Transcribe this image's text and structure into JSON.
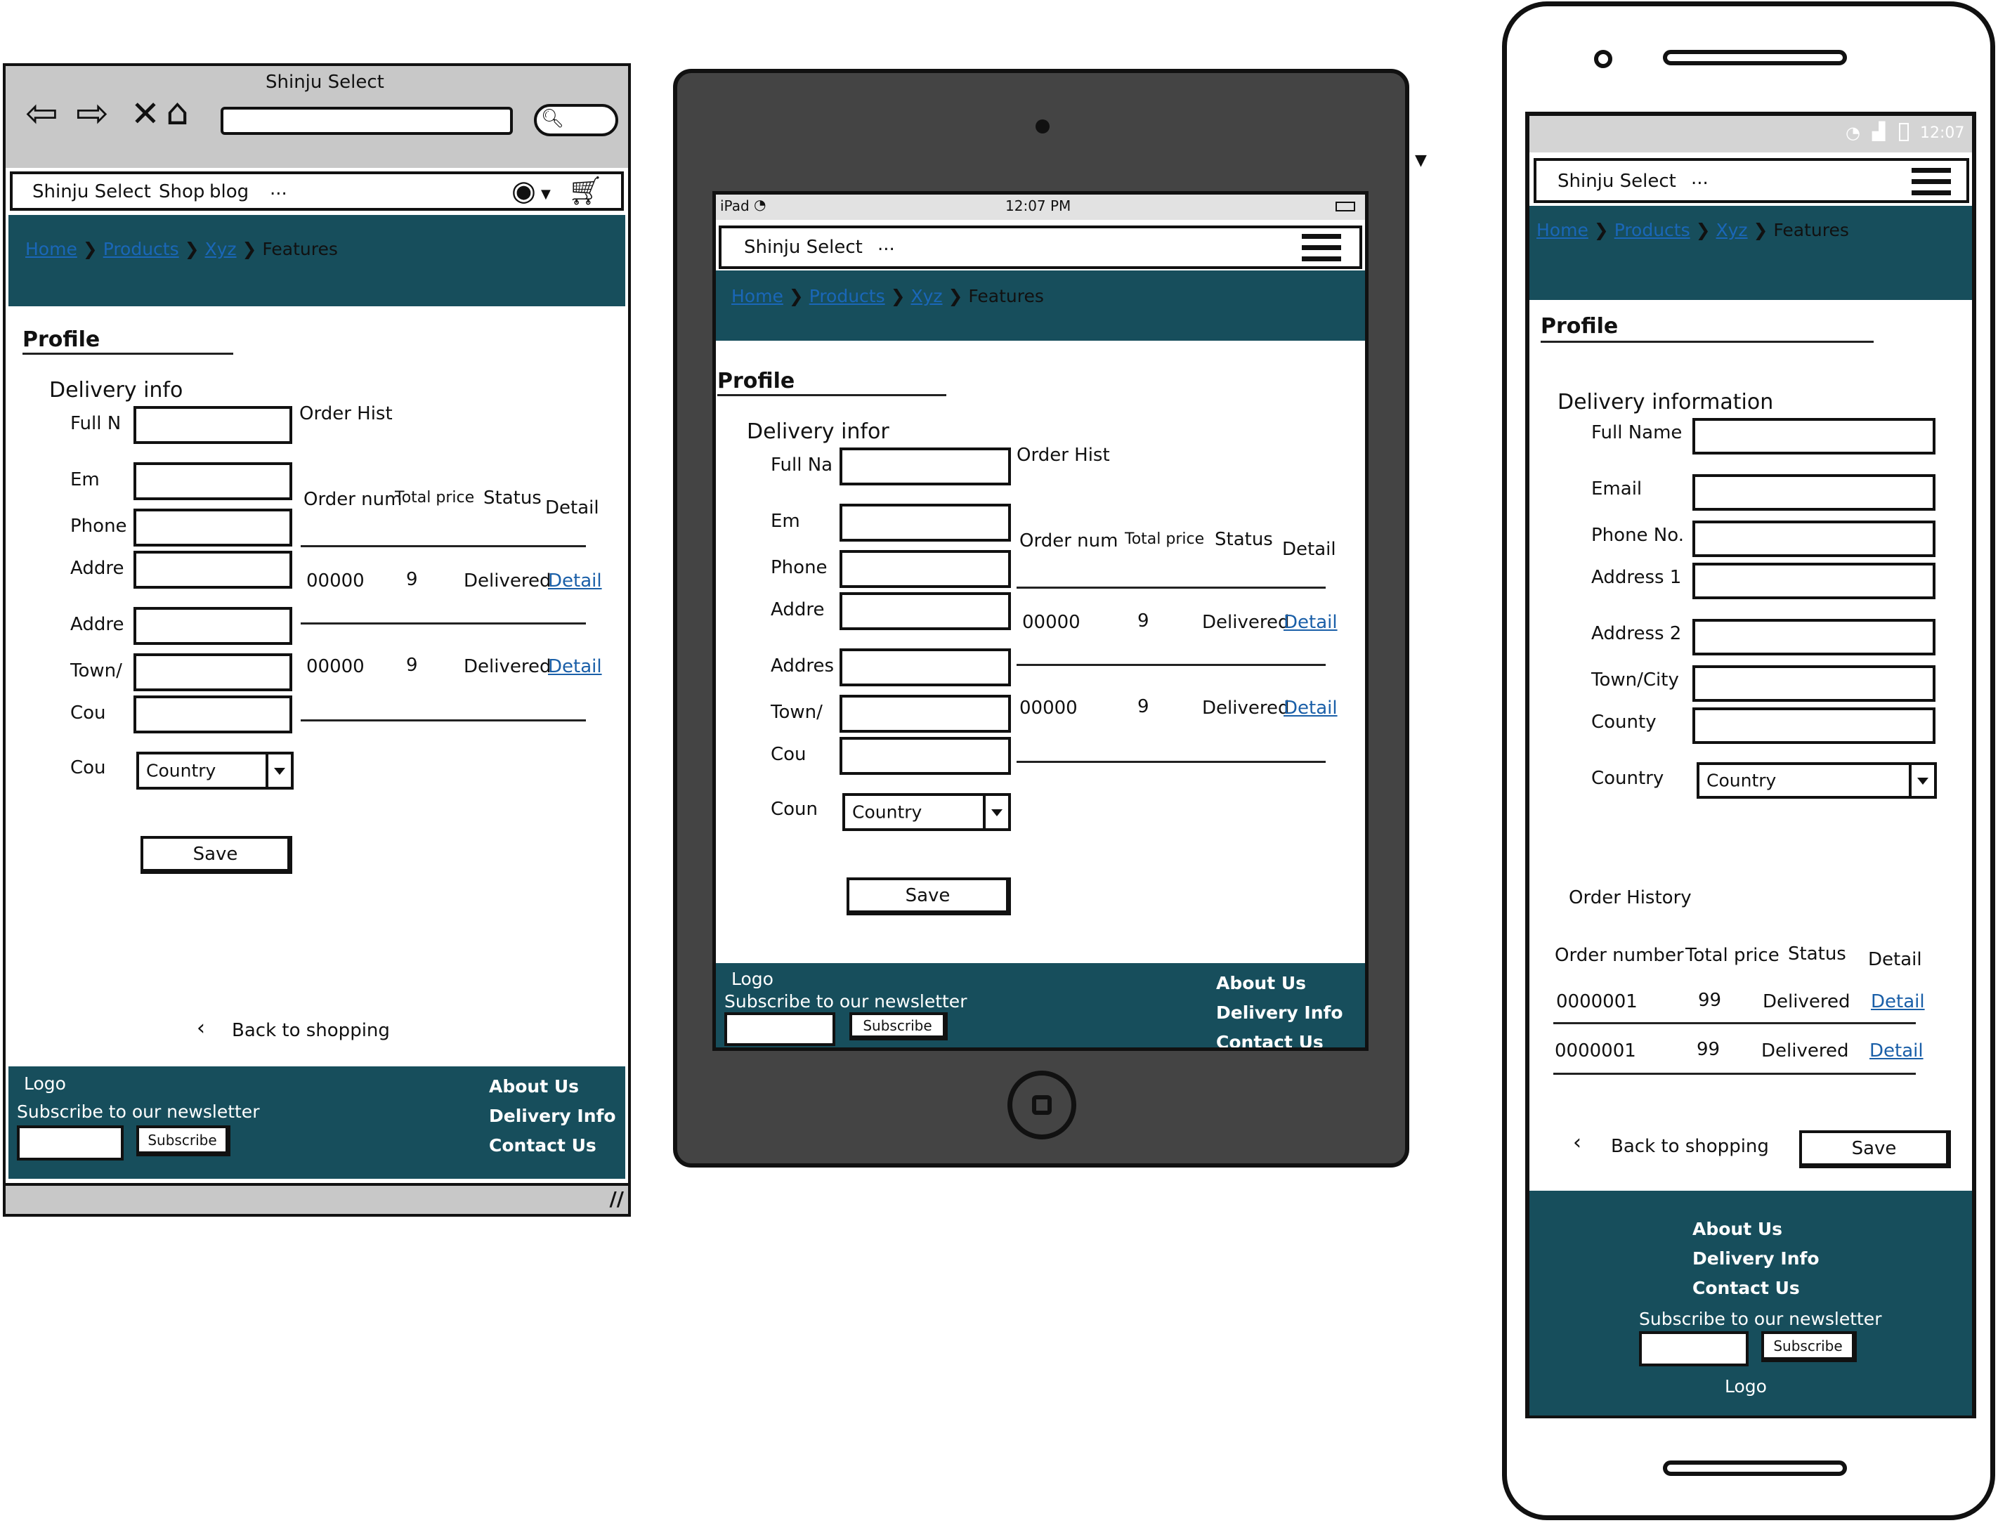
{
  "site_name": "Shinju Select",
  "nav": {
    "shop": "Shop",
    "blog": "blog",
    "more": "..."
  },
  "breadcrumb": {
    "home": "Home",
    "products": "Products",
    "sub": "Xyz",
    "current": "Features"
  },
  "profile_title": "Profile",
  "desktop": {
    "window_title": "Shinju Select",
    "delivery_title": "Delivery info",
    "labels": {
      "full_name": "Full N",
      "email": "Em",
      "phone": "Phone",
      "address1": "Addre",
      "address2": "Addre",
      "town": "Town/",
      "county": "Cou",
      "country": "Cou"
    },
    "order_title": "Order Hist",
    "order_headers": {
      "num": "Order num",
      "price": "Total price",
      "status": "Status",
      "detail": "Detail"
    },
    "orders": [
      {
        "num": "00000",
        "price": "9",
        "status": "Delivered",
        "detail": "Detail"
      },
      {
        "num": "00000",
        "price": "9",
        "status": "Delivered",
        "detail": "Detail"
      }
    ],
    "back": "Back to shopping"
  },
  "tablet": {
    "status_left": "iPad",
    "status_time": "12:07 PM",
    "delivery_title": "Delivery infor",
    "labels": {
      "full_name": "Full Na",
      "email": "Em",
      "phone": "Phone",
      "address1": "Addre",
      "address2": "Addres",
      "town": "Town/",
      "county": "Cou",
      "country": "Coun"
    },
    "order_title": "Order Hist",
    "order_headers": {
      "num": "Order num",
      "price": "Total price",
      "status": "Status",
      "detail": "Detail"
    },
    "orders": [
      {
        "num": "00000",
        "price": "9",
        "status": "Delivered",
        "detail": "Detail"
      },
      {
        "num": "00000",
        "price": "9",
        "status": "Delivered",
        "detail": "Detail"
      }
    ]
  },
  "phone": {
    "status_time": "12:07",
    "delivery_title": "Delivery information",
    "labels": {
      "full_name": "Full Name",
      "email": "Email",
      "phone": "Phone No.",
      "address1": "Address 1",
      "address2": "Address 2",
      "town": "Town/City",
      "county": "County",
      "country": "Country"
    },
    "order_title": "Order History",
    "order_headers": {
      "num": "Order number",
      "price": "Total price",
      "status": "Status",
      "detail": "Detail"
    },
    "orders": [
      {
        "num": "0000001",
        "price": "99",
        "status": "Delivered",
        "detail": "Detail"
      },
      {
        "num": "0000001",
        "price": "99",
        "status": "Delivered",
        "detail": "Detail"
      }
    ],
    "back": "Back to shopping"
  },
  "form": {
    "country_select": "Country",
    "save": "Save"
  },
  "footer": {
    "logo": "Logo",
    "newsletter": "Subscribe to our newsletter",
    "subscribe": "Subscribe",
    "about": "About Us",
    "delivery": "Delivery Info",
    "contact": "Contact Us"
  },
  "colors": {
    "teal": "#174e5c",
    "link": "#1a5fa8",
    "device_frame": "#444444",
    "browser_chrome": "#c8c8c8"
  }
}
